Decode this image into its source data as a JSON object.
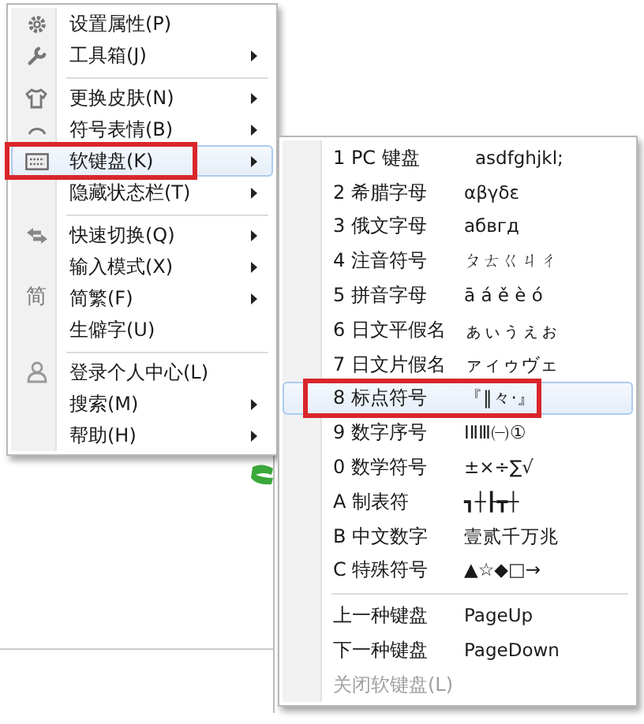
{
  "main_menu": {
    "items": [
      {
        "label": "设置属性(P)",
        "submenu": false,
        "selected": false,
        "separator_before": false
      },
      {
        "label": "工具箱(J)",
        "submenu": true,
        "selected": false,
        "separator_before": false
      },
      {
        "label": "更换皮肤(N)",
        "submenu": true,
        "selected": false,
        "separator_before": true
      },
      {
        "label": "符号表情(B)",
        "submenu": true,
        "selected": false,
        "separator_before": false
      },
      {
        "label": "软键盘(K)",
        "submenu": true,
        "selected": true,
        "separator_before": false
      },
      {
        "label": "隐藏状态栏(T)",
        "submenu": true,
        "selected": false,
        "separator_before": false
      },
      {
        "label": "快速切换(Q)",
        "submenu": true,
        "selected": false,
        "separator_before": true
      },
      {
        "label": "输入模式(X)",
        "submenu": true,
        "selected": false,
        "separator_before": false
      },
      {
        "label": "简繁(F)",
        "submenu": true,
        "selected": false,
        "separator_before": false,
        "icon_text": "简"
      },
      {
        "label": "生僻字(U)",
        "submenu": false,
        "selected": false,
        "separator_before": false
      },
      {
        "label": "登录个人中心(L)",
        "submenu": false,
        "selected": false,
        "separator_before": true
      },
      {
        "label": "搜索(M)",
        "submenu": true,
        "selected": false,
        "separator_before": false
      },
      {
        "label": "帮助(H)",
        "submenu": true,
        "selected": false,
        "separator_before": false
      }
    ]
  },
  "submenu": {
    "items": [
      {
        "label": "1 PC 键盘",
        "sample": "asdfghjkl;",
        "selected": false,
        "disabled": false,
        "separator_before": false
      },
      {
        "label": "2 希腊字母",
        "sample": "αβγδε",
        "selected": false,
        "disabled": false,
        "separator_before": false
      },
      {
        "label": "3 俄文字母",
        "sample": "абвгд",
        "selected": false,
        "disabled": false,
        "separator_before": false
      },
      {
        "label": "4 注音符号",
        "sample": "ㄆㄊㄍㄐㄔ",
        "selected": false,
        "disabled": false,
        "separator_before": false
      },
      {
        "label": "5 拼音字母",
        "sample": "ā á ě è ó",
        "selected": false,
        "disabled": false,
        "separator_before": false
      },
      {
        "label": "6 日文平假名",
        "sample": "ぁぃぅぇぉ",
        "selected": false,
        "disabled": false,
        "separator_before": false
      },
      {
        "label": "7 日文片假名",
        "sample": "ァィゥヴェ",
        "selected": false,
        "disabled": false,
        "separator_before": false
      },
      {
        "label": "8 标点符号",
        "sample": "『‖々·』",
        "selected": true,
        "disabled": false,
        "separator_before": false
      },
      {
        "label": "9 数字序号",
        "sample": "ⅠⅡⅢ㈠①",
        "selected": false,
        "disabled": false,
        "separator_before": false
      },
      {
        "label": "0 数学符号",
        "sample": "±×÷∑√",
        "selected": false,
        "disabled": false,
        "separator_before": false
      },
      {
        "label": "A 制表符",
        "sample": "┓┼┠┳┼",
        "selected": false,
        "disabled": false,
        "separator_before": false
      },
      {
        "label": "B 中文数字",
        "sample": "壹贰千万兆",
        "selected": false,
        "disabled": false,
        "separator_before": false
      },
      {
        "label": "C 特殊符号",
        "sample": "▲☆◆□→",
        "selected": false,
        "disabled": false,
        "separator_before": false
      },
      {
        "label": "上一种键盘",
        "sample": "PageUp",
        "selected": false,
        "disabled": false,
        "separator_before": true
      },
      {
        "label": "下一种键盘",
        "sample": "PageDown",
        "selected": false,
        "disabled": false,
        "separator_before": false
      },
      {
        "label": "关闭软键盘(L)",
        "selected": false,
        "disabled": true,
        "separator_before": false
      }
    ]
  }
}
